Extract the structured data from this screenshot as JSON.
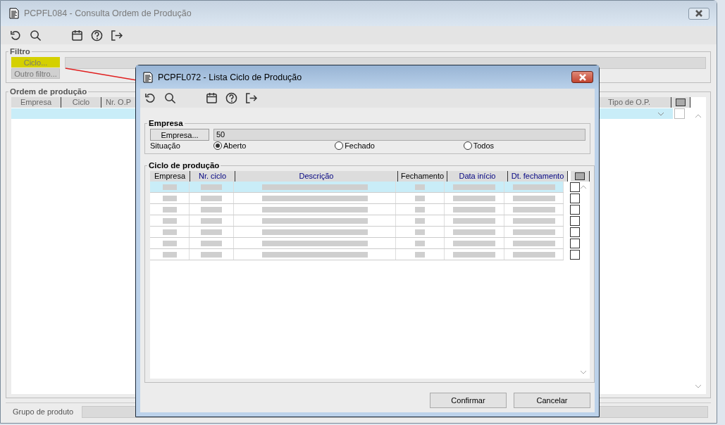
{
  "main_window": {
    "title": "PCPFL084 - Consulta Ordem de Produção",
    "filter": {
      "legend": "Filtro",
      "buttons": [
        {
          "label": "Ciclo...",
          "highlighted": true
        },
        {
          "label": "Outro filtro...",
          "highlighted": false
        }
      ]
    },
    "orders": {
      "legend": "Ordem de produção",
      "columns": [
        "Empresa",
        "Ciclo",
        "Nr. O.P",
        "Tipo de O.P."
      ],
      "rows": [
        {
          "selected": true,
          "checked": false
        }
      ]
    },
    "product_group": {
      "label": "Grupo de produto"
    }
  },
  "dialog": {
    "title": "PCPFL072 - Lista Ciclo de Produção",
    "company": {
      "legend": "Empresa",
      "button": "Empresa...",
      "value": "50",
      "status_label": "Situação",
      "options": [
        {
          "label": "Aberto",
          "selected": true
        },
        {
          "label": "Fechado",
          "selected": false
        },
        {
          "label": "Todos",
          "selected": false
        }
      ]
    },
    "cycles": {
      "legend": "Ciclo de produção",
      "columns": [
        {
          "label": "Empresa",
          "highlighted": false
        },
        {
          "label": "Nr. ciclo",
          "highlighted": true
        },
        {
          "label": "Descrição",
          "highlighted": true
        },
        {
          "label": "Fechamento",
          "highlighted": false
        },
        {
          "label": "Data início",
          "highlighted": true
        },
        {
          "label": "Dt. fechamento",
          "highlighted": true
        }
      ],
      "rows": [
        {
          "selected": true,
          "checked": false
        },
        {
          "selected": false,
          "checked": false
        },
        {
          "selected": false,
          "checked": false
        },
        {
          "selected": false,
          "checked": false
        },
        {
          "selected": false,
          "checked": false
        },
        {
          "selected": false,
          "checked": false
        },
        {
          "selected": false,
          "checked": false
        }
      ]
    },
    "buttons": [
      "Confirmar",
      "Cancelar"
    ]
  }
}
